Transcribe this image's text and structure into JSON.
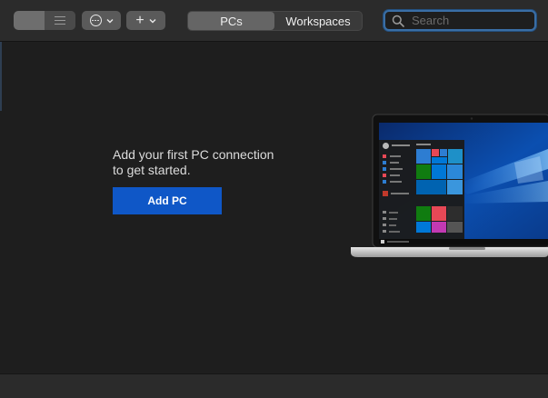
{
  "toolbar": {
    "view_toggle": {
      "grid_icon": "grid-icon",
      "list_icon": "list-icon"
    },
    "more_button_icon": "ellipsis-circle-icon",
    "add_button_icon": "plus-icon",
    "tabs": [
      {
        "label": "PCs",
        "selected": true
      },
      {
        "label": "Workspaces",
        "selected": false
      }
    ],
    "search": {
      "placeholder": "Search",
      "value": ""
    }
  },
  "empty_state": {
    "message_line1": "Add your first PC connection",
    "message_line2": "to get started.",
    "button_label": "Add PC"
  },
  "colors": {
    "accent": "#0f57c7",
    "search_focus": "#3a6ea5",
    "window_bg": "#1e1e1e",
    "toolbar_bg": "#2b2b2b"
  }
}
